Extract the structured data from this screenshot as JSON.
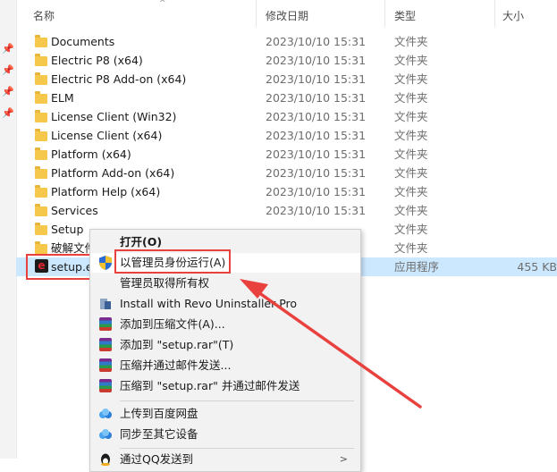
{
  "columns": {
    "name": "名称",
    "date": "修改日期",
    "type": "类型",
    "size": "大小"
  },
  "files": [
    {
      "name": "Documents",
      "date": "2023/10/10 15:31",
      "type": "文件夹",
      "size": "",
      "icon": "folder"
    },
    {
      "name": "Electric P8 (x64)",
      "date": "2023/10/10 15:31",
      "type": "文件夹",
      "size": "",
      "icon": "folder"
    },
    {
      "name": "Electric P8 Add-on (x64)",
      "date": "2023/10/10 15:31",
      "type": "文件夹",
      "size": "",
      "icon": "folder"
    },
    {
      "name": "ELM",
      "date": "2023/10/10 15:31",
      "type": "文件夹",
      "size": "",
      "icon": "folder"
    },
    {
      "name": "License Client (Win32)",
      "date": "2023/10/10 15:31",
      "type": "文件夹",
      "size": "",
      "icon": "folder"
    },
    {
      "name": "License Client (x64)",
      "date": "2023/10/10 15:31",
      "type": "文件夹",
      "size": "",
      "icon": "folder"
    },
    {
      "name": "Platform (x64)",
      "date": "2023/10/10 15:31",
      "type": "文件夹",
      "size": "",
      "icon": "folder"
    },
    {
      "name": "Platform Add-on (x64)",
      "date": "2023/10/10 15:31",
      "type": "文件夹",
      "size": "",
      "icon": "folder"
    },
    {
      "name": "Platform Help (x64)",
      "date": "2023/10/10 15:31",
      "type": "文件夹",
      "size": "",
      "icon": "folder"
    },
    {
      "name": "Services",
      "date": "2023/10/10 15:31",
      "type": "文件夹",
      "size": "",
      "icon": "folder"
    },
    {
      "name": "Setup",
      "date": "",
      "type": "文件夹",
      "size": "",
      "icon": "folder"
    },
    {
      "name": "破解文件",
      "date": "",
      "type": "文件夹",
      "size": "",
      "icon": "folder"
    },
    {
      "name": "setup.e",
      "date": "",
      "type": "应用程序",
      "size": "455 KB",
      "icon": "exe",
      "selected": true
    }
  ],
  "context_menu": {
    "open": "打开(O)",
    "run_as_admin": "以管理员身份运行(A)",
    "take_ownership": "管理员取得所有权",
    "revo_install": "Install with Revo Uninstaller Pro",
    "add_to_archive": "添加到压缩文件(A)...",
    "add_to_rar": "添加到 \"setup.rar\"(T)",
    "compress_email": "压缩并通过邮件发送...",
    "compress_rar_email": "压缩到 \"setup.rar\" 并通过邮件发送",
    "upload_baidu": "上传到百度网盘",
    "sync_device": "同步至其它设备",
    "send_qq": "通过QQ发送到"
  },
  "colors": {
    "annotation_red": "#e8413e",
    "selection_blue": "#cce8ff",
    "folder_yellow": "#f5c84c"
  }
}
